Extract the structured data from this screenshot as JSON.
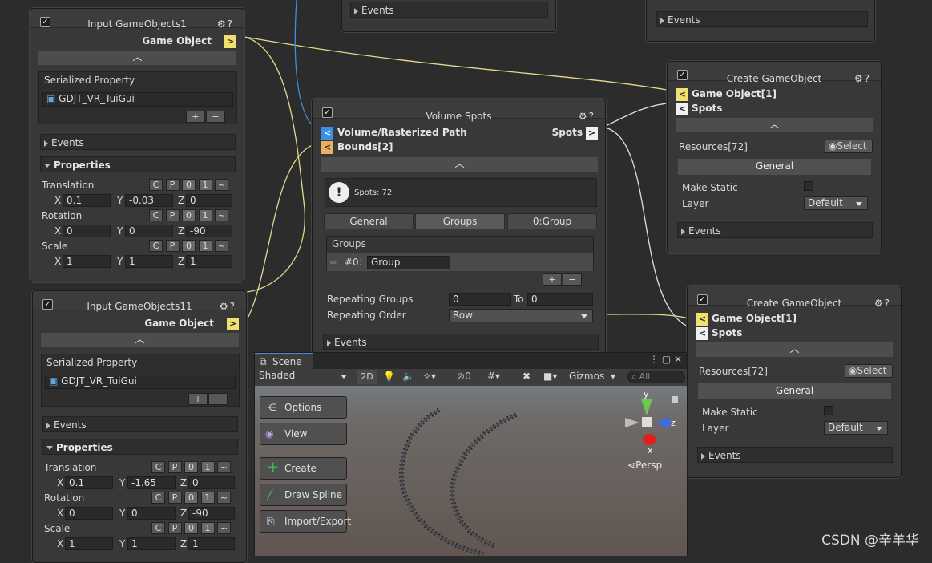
{
  "colors": {
    "port_yellow": "#f0e070",
    "port_blue": "#3a8fe8",
    "port_orange": "#e8b060",
    "wire_yellow": "#e6d98a",
    "wire_blue": "#3d8fe0",
    "wire_white": "#e0e0e0"
  },
  "top_stub_left": {
    "events": "Events"
  },
  "top_stub_right": {
    "events": "Events"
  },
  "input1": {
    "title": "Input GameObjects1",
    "port": "Game Object",
    "port_glyph": ">",
    "serialized": "Serialized Property",
    "object": "GDJT_VR_TuiGui",
    "plus": "+",
    "minus": "−",
    "events": "Events",
    "properties": "Properties",
    "translation": "Translation",
    "rotation": "Rotation",
    "scale": "Scale",
    "btn_c": "C",
    "btn_p": "P",
    "btn_0": "0",
    "btn_1": "1",
    "btn_t": "~",
    "tx": "X",
    "tx_v": "0.1",
    "ty": "Y",
    "ty_v": "-0.03",
    "tz": "Z",
    "tz_v": "0",
    "rx_v": "0",
    "ry_v": "0",
    "rz_v": "-90",
    "sx_v": "1",
    "sy_v": "1",
    "sz_v": "1"
  },
  "input11": {
    "title": "Input GameObjects11",
    "port": "Game Object",
    "port_glyph": ">",
    "serialized": "Serialized Property",
    "object": "GDJT_VR_TuiGui",
    "plus": "+",
    "minus": "−",
    "events": "Events",
    "properties": "Properties",
    "translation": "Translation",
    "rotation": "Rotation",
    "scale": "Scale",
    "tx_v": "0.1",
    "ty_v": "-1.65",
    "tz_v": "0",
    "rx_v": "0",
    "ry_v": "0",
    "rz_v": "-90",
    "sx_v": "1",
    "sy_v": "1",
    "sz_v": "1"
  },
  "volume": {
    "title": "Volume Spots",
    "in1": "Volume/Rasterized Path",
    "in2": "Bounds[2]",
    "out": "Spots",
    "in_glyph": "<",
    "out_glyph": ">",
    "info": "Spots: 72",
    "tabs": [
      "General",
      "Groups",
      "0:Group"
    ],
    "groups_label": "Groups",
    "group_index": "#0:",
    "group_name": "Group",
    "plus": "+",
    "minus": "−",
    "repeating_groups": "Repeating Groups",
    "rg_from": "0",
    "rg_to_label": "To",
    "rg_to": "0",
    "repeating_order": "Repeating Order",
    "order_value": "Row",
    "events": "Events"
  },
  "create1": {
    "title": "Create GameObject",
    "in1": "Game Object[1]",
    "in2": "Spots",
    "resources": "Resources[72]",
    "select": "Select",
    "general": "General",
    "make_static": "Make Static",
    "layer": "Layer",
    "layer_value": "Default",
    "events": "Events"
  },
  "create2": {
    "title": "Create GameObject",
    "in1": "Game Object[1]",
    "in2": "Spots",
    "resources": "Resources[72]",
    "select": "Select",
    "general": "General",
    "make_static": "Make Static",
    "layer": "Layer",
    "layer_value": "Default",
    "events": "Events"
  },
  "scene": {
    "tab": "Scene",
    "shading": "Shaded",
    "mode_2d": "2D",
    "hidden_count": "0",
    "gizmos": "Gizmos",
    "search_placeholder": "All",
    "buttons": [
      "Options",
      "View",
      "Create",
      "Draw Spline",
      "Import/Export"
    ],
    "persp": "Persp",
    "axis_y": "y",
    "axis_x": "x",
    "axis_z": "z"
  },
  "watermark": "CSDN @辛羊华"
}
